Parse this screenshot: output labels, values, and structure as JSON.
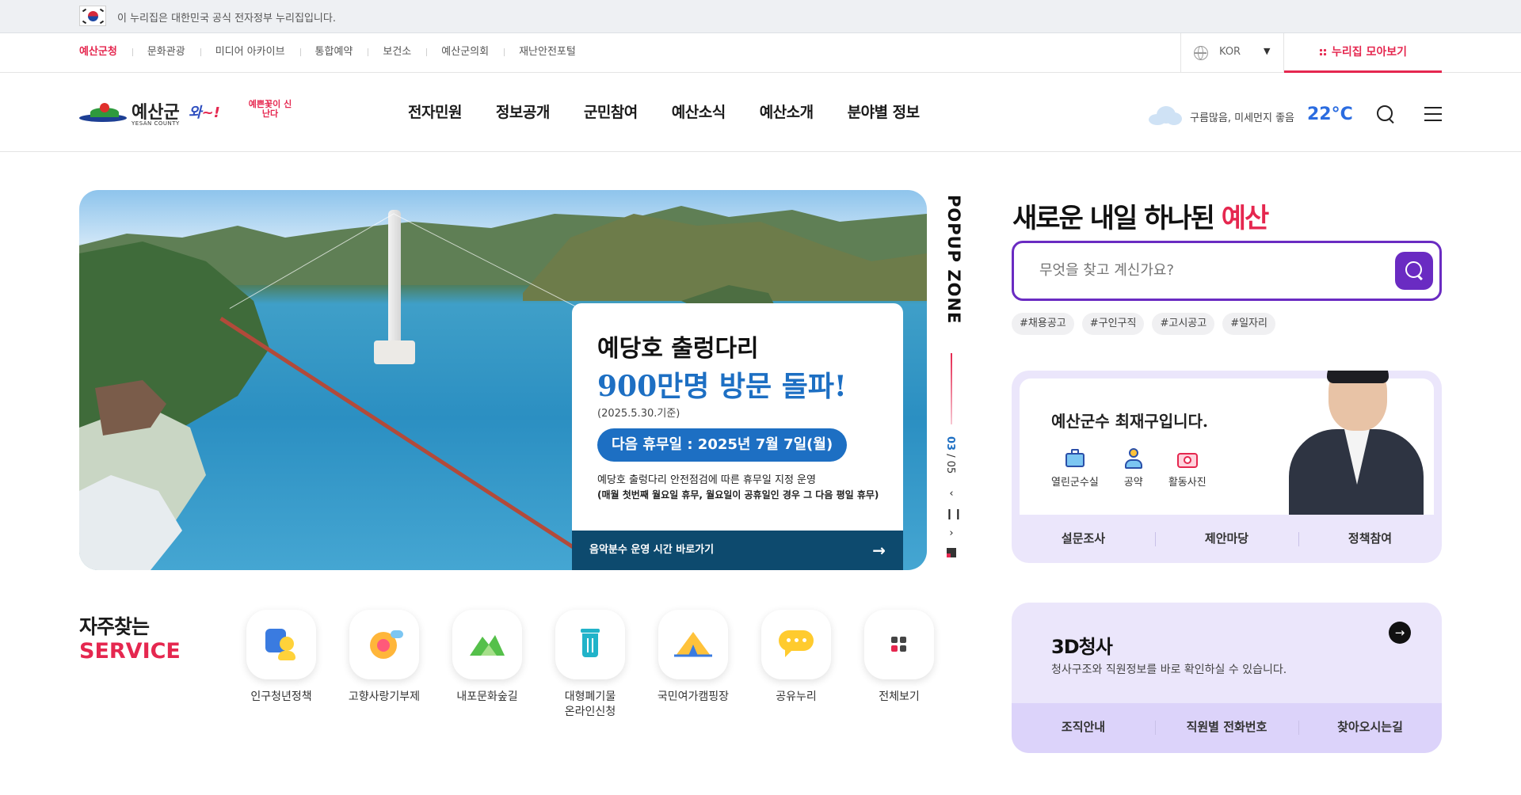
{
  "gov_banner": {
    "text": "이 누리집은 대한민국 공식 전자정부 누리집입니다."
  },
  "util": {
    "links": [
      "예산군청",
      "문화관광",
      "미디어 아카이브",
      "통합예약",
      "보건소",
      "예산군의회",
      "재난안전포털"
    ],
    "language": "KOR",
    "nuri_button": "누리집 모아보기"
  },
  "header": {
    "logo_name": "예산군",
    "logo_english": "YESAN COUNTY",
    "slogan_a": "와",
    "slogan_b": "~!",
    "slogan_c": "예쁜꽃이 신난다",
    "nav": [
      "전자민원",
      "정보공개",
      "군민참여",
      "예산소식",
      "예산소개",
      "분야별 정보"
    ],
    "weather_text": "구름많음,   미세먼지 좋음",
    "temperature": "22°C"
  },
  "hero": {
    "title": "예당호 출렁다리",
    "highlight": "900만명 방문 돌파!",
    "date": "(2025.5.30.기준)",
    "holiday": "다음 휴무일 : 2025년 7월 7일(월)",
    "note1": "예당호 출렁다리 안전점검에 따른 휴무일 지정 운영",
    "note2": "(매월 첫번째 월요일 휴무, 월요일이 공휴일인 경우 그 다음 평일 휴무)",
    "footer_link": "음악분수 운영 시간 바로가기"
  },
  "popup": {
    "label": "POPUP ZONE",
    "current": "03",
    "total": "05"
  },
  "services": {
    "title_ko": "자주찾는",
    "title_en": "SERVICE",
    "items": [
      {
        "label": "인구청년정책",
        "icon": "population-icon"
      },
      {
        "label": "고향사랑기부제",
        "icon": "hometown-donation-icon"
      },
      {
        "label": "내포문화숲길",
        "icon": "forest-trail-icon"
      },
      {
        "label": "대형폐기물\n온라인신청",
        "icon": "waste-bin-icon"
      },
      {
        "label": "국민여가캠핑장",
        "icon": "camping-icon"
      },
      {
        "label": "공유누리",
        "icon": "sharing-icon"
      },
      {
        "label": "전체보기",
        "icon": "grid-icon"
      }
    ]
  },
  "search": {
    "slogan_a": "새로운 내일 하나된 ",
    "slogan_b": "예산",
    "placeholder": "무엇을 찾고 계신가요?",
    "tags": [
      "#채용공고",
      "#구인구직",
      "#고시공고",
      "#일자리"
    ]
  },
  "mayor": {
    "title": "예산군수 최재구입니다.",
    "links": [
      "열린군수실",
      "공약",
      "활동사진"
    ],
    "bottom": [
      "설문조사",
      "제안마당",
      "정책참여"
    ]
  },
  "hall": {
    "title": "3D청사",
    "desc": "청사구조와 직원정보를 바로 확인하실 수 있습니다.",
    "bottom": [
      "조직안내",
      "직원별 전화번호",
      "찾아오시는길"
    ]
  },
  "colors": {
    "accent": "#e5274f",
    "purple": "#6a2bc2",
    "blue": "#1d6fc3",
    "navy": "#0d4a6e"
  }
}
